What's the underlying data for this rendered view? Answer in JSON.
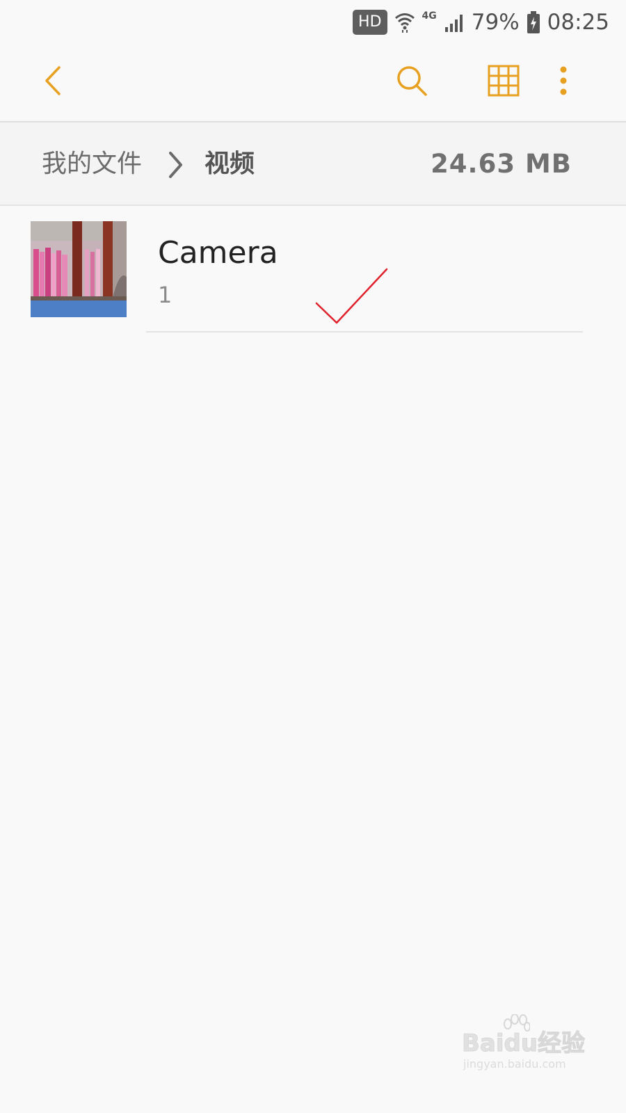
{
  "status_bar": {
    "hd_label": "HD",
    "network_type": "4G",
    "battery_percent": "79%",
    "time": "08:25",
    "icons": [
      "wifi-icon",
      "signal-icon",
      "battery-charging-icon"
    ]
  },
  "app_bar": {
    "accent_color": "#e8a020",
    "icons": [
      "back-arrow-icon",
      "search-icon",
      "grid-view-icon",
      "more-options-icon"
    ]
  },
  "breadcrumb": {
    "parent": "我的文件",
    "current": "视频",
    "total_size": "24.63 MB"
  },
  "folders": [
    {
      "name": "Camera",
      "count": "1",
      "thumbnail": "video-thumbnail"
    }
  ],
  "annotation": {
    "type": "check-mark",
    "color": "#e0202a"
  },
  "watermark": {
    "brand": "Baidu经验",
    "url": "jingyan.baidu.com"
  }
}
